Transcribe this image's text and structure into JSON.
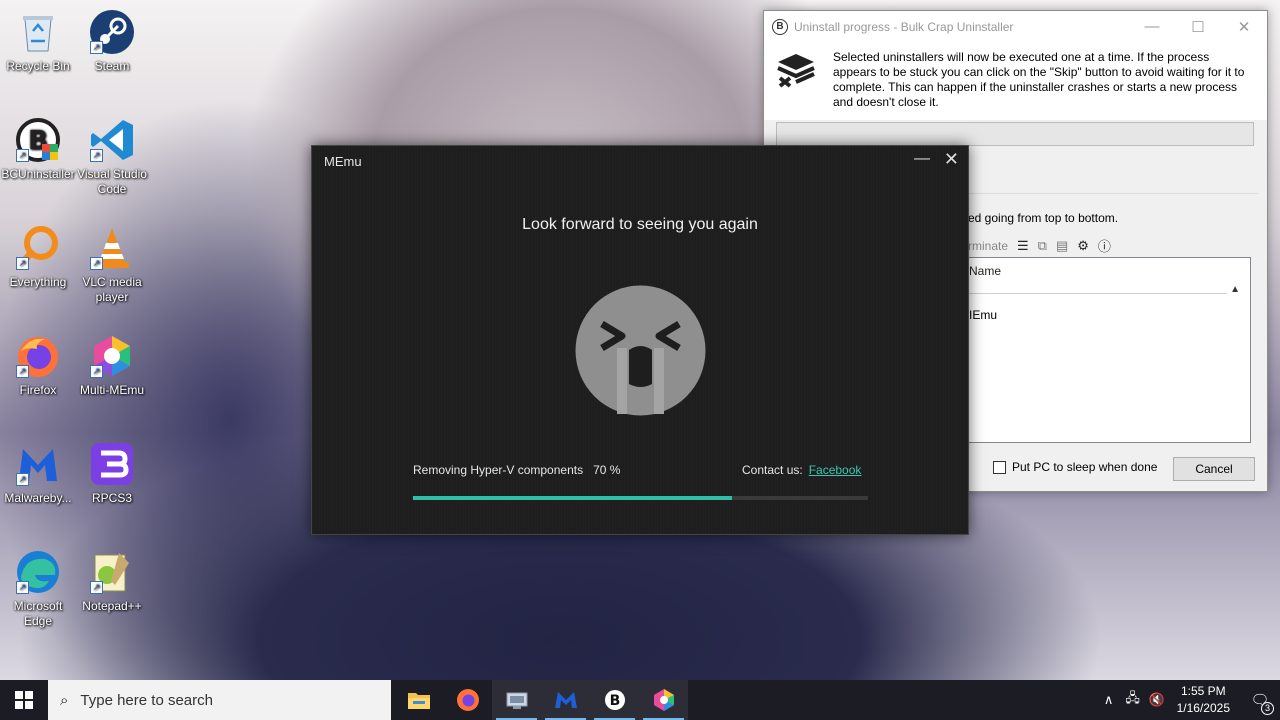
{
  "desktop": {
    "icons": [
      {
        "label": "Recycle Bin",
        "icon": "recycle-bin-icon"
      },
      {
        "label": "Steam",
        "icon": "steam-icon"
      },
      {
        "label": "BCUninstaller",
        "icon": "bcu-icon"
      },
      {
        "label": "Visual Studio Code",
        "icon": "vscode-icon"
      },
      {
        "label": "Everything",
        "icon": "everything-icon"
      },
      {
        "label": "VLC media player",
        "icon": "vlc-icon"
      },
      {
        "label": "Firefox",
        "icon": "firefox-icon"
      },
      {
        "label": "Multi-MEmu",
        "icon": "multi-memu-icon"
      },
      {
        "label": "Malwareby...",
        "icon": "malwarebytes-icon"
      },
      {
        "label": "RPCS3",
        "icon": "rpcs3-icon"
      },
      {
        "label": "Microsoft Edge",
        "icon": "edge-icon"
      },
      {
        "label": "Notepad++",
        "icon": "notepadpp-icon"
      }
    ]
  },
  "bcu": {
    "title": "Uninstall progress - Bulk Crap Uninstaller",
    "logo": "B",
    "message": "Selected uninstallers will now be executed one at a time. If the process appears to be stuck you can click on the \"Skip\" button to avoid waiting for it to complete. This can happen if the uninstaller crashes or starts a new process and doesn't close it.",
    "description": "ed going from top to bottom.",
    "toolbar_label": "rminate",
    "column_name": "Name",
    "row_name": "IEmu",
    "sleep_label": "Put PC to sleep when done",
    "sleep_checked": false,
    "cancel_label": "Cancel"
  },
  "memu": {
    "title": "MEmu",
    "heading": "Look forward to seeing you again",
    "status_text": "Removing Hyper-V components",
    "progress_label": "70 %",
    "progress_value": 0.7,
    "contact_label": "Contact us:",
    "facebook_link": "Facebook",
    "accent_color": "#2fbfa8"
  },
  "taskbar": {
    "search_placeholder": "Type here to search",
    "apps": [
      "file-explorer-icon",
      "firefox-icon",
      "network-app-icon",
      "memu-icon",
      "bcu-icon",
      "multi-memu-icon"
    ],
    "time": "1:55 PM",
    "date": "1/16/2025",
    "notification_count": "3"
  }
}
